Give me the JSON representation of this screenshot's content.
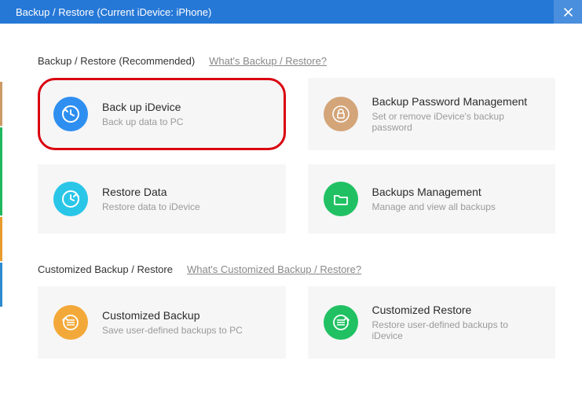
{
  "titlebar": {
    "title": "Backup / Restore   (Current iDevice: iPhone)"
  },
  "sections": {
    "recommended": {
      "title": "Backup / Restore (Recommended)",
      "help": "What's Backup / Restore?"
    },
    "customized": {
      "title": "Customized Backup / Restore",
      "help": "What's Customized Backup / Restore?"
    }
  },
  "cards": {
    "backup_idevice": {
      "title": "Back up iDevice",
      "sub": "Back up data to PC"
    },
    "password": {
      "title": "Backup Password Management",
      "sub": "Set or remove iDevice's backup password"
    },
    "restore_data": {
      "title": "Restore Data",
      "sub": "Restore data to iDevice"
    },
    "backups_mgmt": {
      "title": "Backups Management",
      "sub": "Manage and view all backups"
    },
    "custom_backup": {
      "title": "Customized Backup",
      "sub": "Save user-defined backups to PC"
    },
    "custom_restore": {
      "title": "Customized Restore",
      "sub": "Restore user-defined backups to iDevice"
    }
  }
}
